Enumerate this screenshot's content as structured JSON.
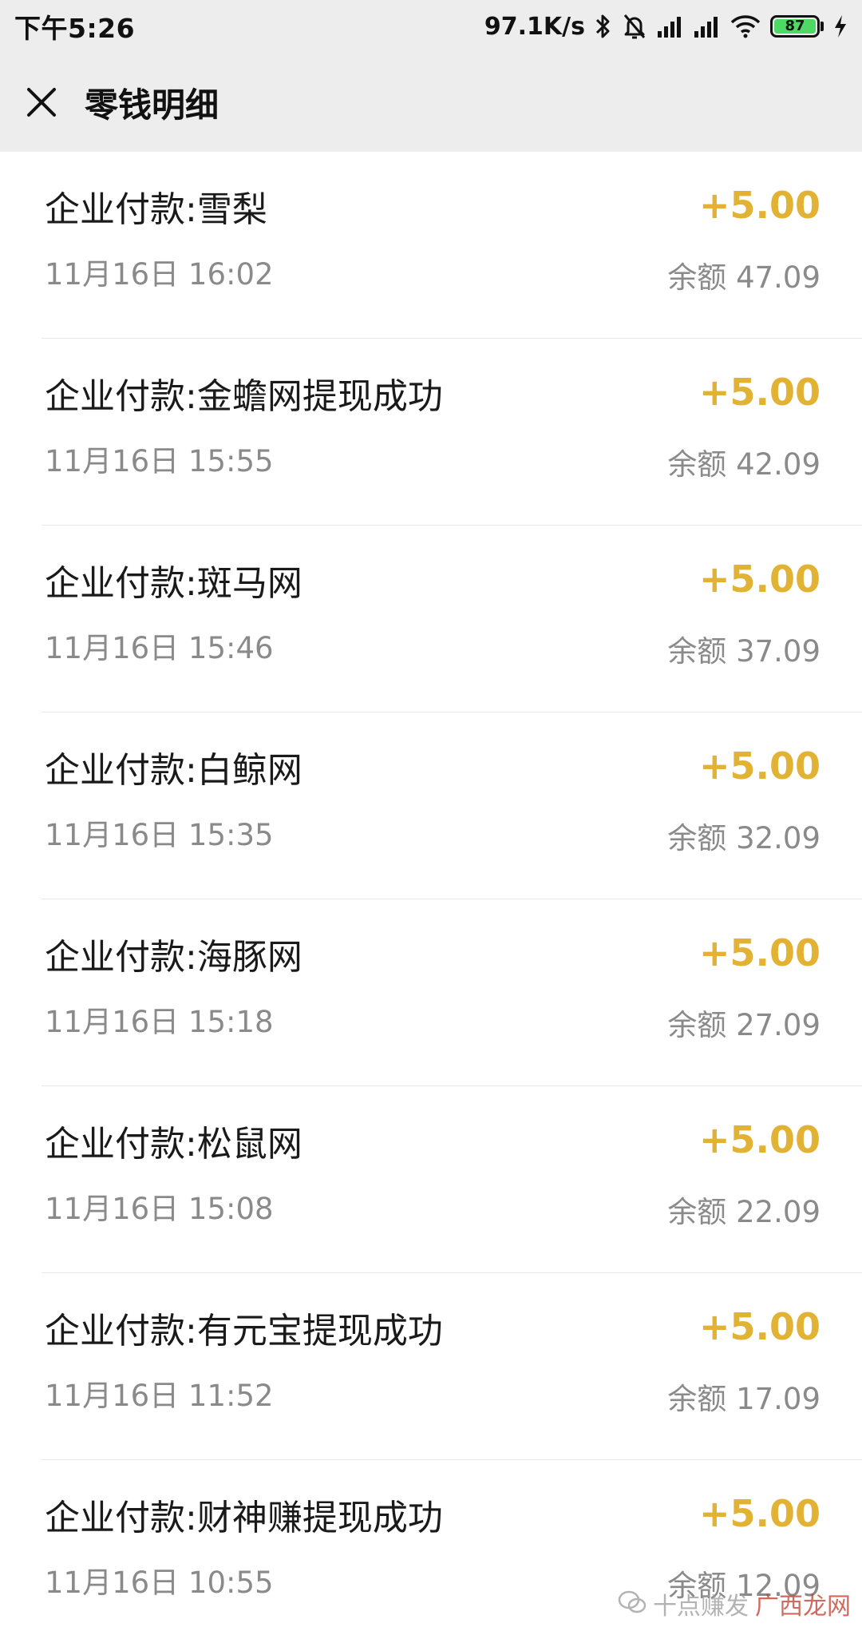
{
  "status_bar": {
    "time": "下午5:26",
    "net_speed": "97.1K/s",
    "battery": "87",
    "icons": [
      "bluetooth-icon",
      "mute-bell-icon",
      "signal-icon",
      "signal-icon",
      "wifi-icon",
      "battery-icon",
      "charging-icon"
    ]
  },
  "header": {
    "title": "零钱明细",
    "close_icon": "close-icon"
  },
  "transactions": [
    {
      "name": "企业付款:雪梨",
      "date": "11月16日 16:02",
      "amount": "+5.00",
      "balance": "余额 47.09"
    },
    {
      "name": "企业付款:金蟾网提现成功",
      "date": "11月16日 15:55",
      "amount": "+5.00",
      "balance": "余额 42.09"
    },
    {
      "name": "企业付款:斑马网",
      "date": "11月16日 15:46",
      "amount": "+5.00",
      "balance": "余额 37.09"
    },
    {
      "name": "企业付款:白鲸网",
      "date": "11月16日 15:35",
      "amount": "+5.00",
      "balance": "余额 32.09"
    },
    {
      "name": "企业付款:海豚网",
      "date": "11月16日 15:18",
      "amount": "+5.00",
      "balance": "余额 27.09"
    },
    {
      "name": "企业付款:松鼠网",
      "date": "11月16日 15:08",
      "amount": "+5.00",
      "balance": "余额 22.09"
    },
    {
      "name": "企业付款:有元宝提现成功",
      "date": "11月16日 11:52",
      "amount": "+5.00",
      "balance": "余额 17.09"
    },
    {
      "name": "企业付款:财神赚提现成功",
      "date": "11月16日 10:55",
      "amount": "+5.00",
      "balance": "余额 12.09"
    }
  ],
  "colors": {
    "amount": "#e2b234",
    "secondary_text": "#8a8a8a",
    "header_bg": "#ededed"
  },
  "watermark": {
    "text": "十点赚发",
    "site": "广西龙网"
  }
}
